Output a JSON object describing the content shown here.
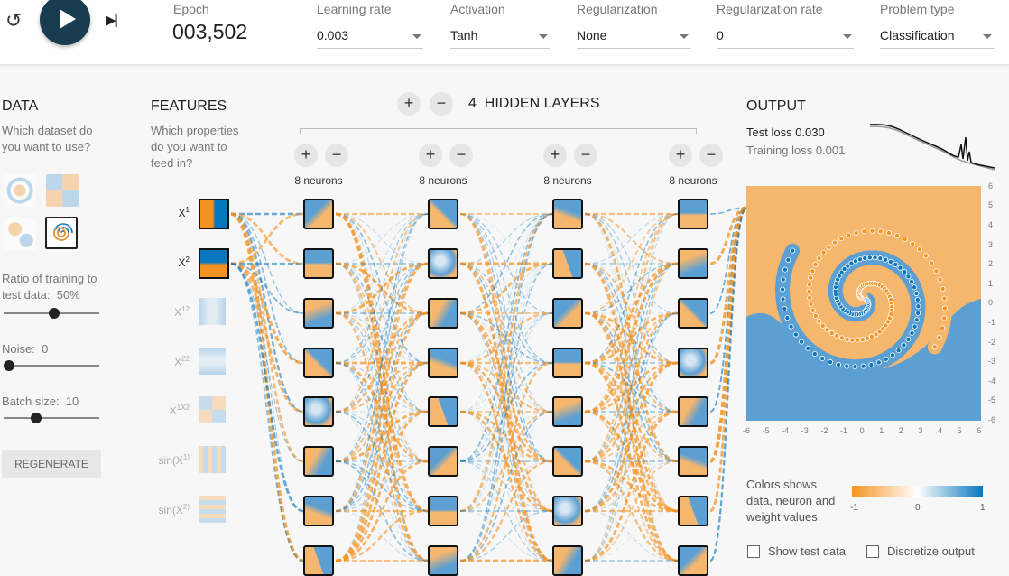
{
  "toolbar": {
    "reset_icon": "reset-icon",
    "play_icon": "play-icon",
    "step_icon": "step-forward-icon",
    "epoch_label": "Epoch",
    "epoch_value": "003,502",
    "learning_rate": {
      "label": "Learning rate",
      "value": "0.003"
    },
    "activation": {
      "label": "Activation",
      "value": "Tanh"
    },
    "regularization": {
      "label": "Regularization",
      "value": "None"
    },
    "regularization_rate": {
      "label": "Regularization rate",
      "value": "0"
    },
    "problem_type": {
      "label": "Problem type",
      "value": "Classification"
    }
  },
  "data_panel": {
    "title": "DATA",
    "question": "Which dataset do you want to use?",
    "datasets": [
      "circle",
      "xor",
      "gaussian",
      "spiral"
    ],
    "selected_dataset": "spiral",
    "ratio_label": "Ratio of training to test data:",
    "ratio_value": "50%",
    "ratio_fraction": 0.5,
    "noise_label": "Noise:",
    "noise_value": "0",
    "noise_fraction": 0.0,
    "batch_label": "Batch size:",
    "batch_value": "10",
    "batch_fraction": 0.3,
    "regenerate_label": "REGENERATE"
  },
  "features_panel": {
    "title": "FEATURES",
    "question": "Which properties do you want to feed in?",
    "features": [
      {
        "label": "X",
        "sub": "1",
        "active": true
      },
      {
        "label": "X",
        "sub": "2",
        "active": true
      },
      {
        "label": "X",
        "sub": "12",
        "active": false
      },
      {
        "label": "X",
        "sub": "22",
        "active": false
      },
      {
        "label": "X",
        "sub": "1X2",
        "active": false
      },
      {
        "label": "sin(X",
        "sub": "1)",
        "active": false
      },
      {
        "label": "sin(X",
        "sub": "2)",
        "active": false
      }
    ]
  },
  "network": {
    "plus_label": "+",
    "minus_label": "−",
    "layer_count": "4",
    "layers_label": "HIDDEN LAYERS",
    "layers": [
      {
        "neurons_label": "8 neurons"
      },
      {
        "neurons_label": "8 neurons"
      },
      {
        "neurons_label": "8 neurons"
      },
      {
        "neurons_label": "8 neurons"
      }
    ]
  },
  "output_panel": {
    "title": "OUTPUT",
    "test_loss_label": "Test loss",
    "test_loss_value": "0.030",
    "training_loss_label": "Training loss",
    "training_loss_value": "0.001",
    "axis_ticks": [
      "-6",
      "-5",
      "-4",
      "-3",
      "-2",
      "-1",
      "0",
      "1",
      "2",
      "3",
      "4",
      "5",
      "6"
    ],
    "color_legend_text": "Colors shows data, neuron and weight values.",
    "legend_ticks": [
      "-1",
      "0",
      "1"
    ],
    "show_test_data_label": "Show test data",
    "discretize_label": "Discretize output"
  },
  "colors": {
    "orange": "#f59322",
    "blue": "#0877bd",
    "dark": "#183d4e",
    "bg_orange": "#f5b66e",
    "bg_blue": "#5b9fd3"
  }
}
